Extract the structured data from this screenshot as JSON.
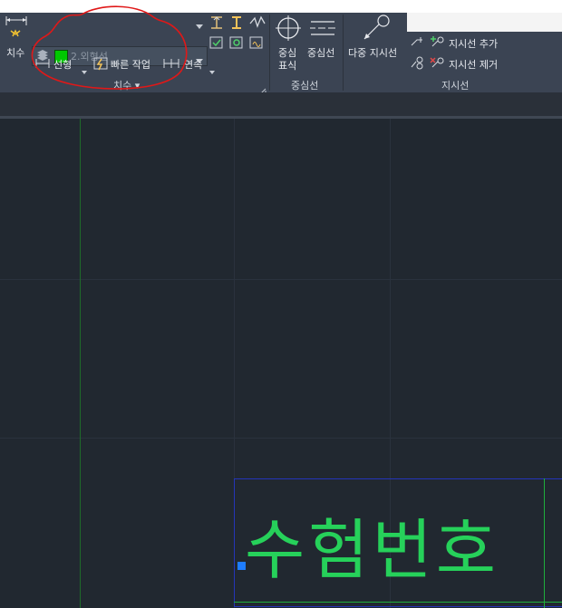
{
  "ribbon": {
    "dimension_panel": {
      "big_button_label": "치수",
      "layer_name": "2.외형선",
      "linear_label": "선형",
      "quick_label": "빠른 작업",
      "continue_label": "연속",
      "panel_title": "치수 ▾"
    },
    "centerline_panel": {
      "center_mark_line1": "중심",
      "center_mark_line2": "표식",
      "centerline_label": "중심선",
      "panel_title": "중심선"
    },
    "leader_panel": {
      "multileader_label": "다중 지시선",
      "add_leader_label": "지시선 추가",
      "remove_leader_label": "지시선 제거",
      "panel_title": "지시선"
    }
  },
  "canvas": {
    "text_object": "수험번호"
  },
  "colors": {
    "ribbon_bg": "#3b4453",
    "canvas_bg": "#212830",
    "layer_color": "#00c800",
    "text_color": "#26d15a",
    "annotation_red": "#e01818"
  }
}
